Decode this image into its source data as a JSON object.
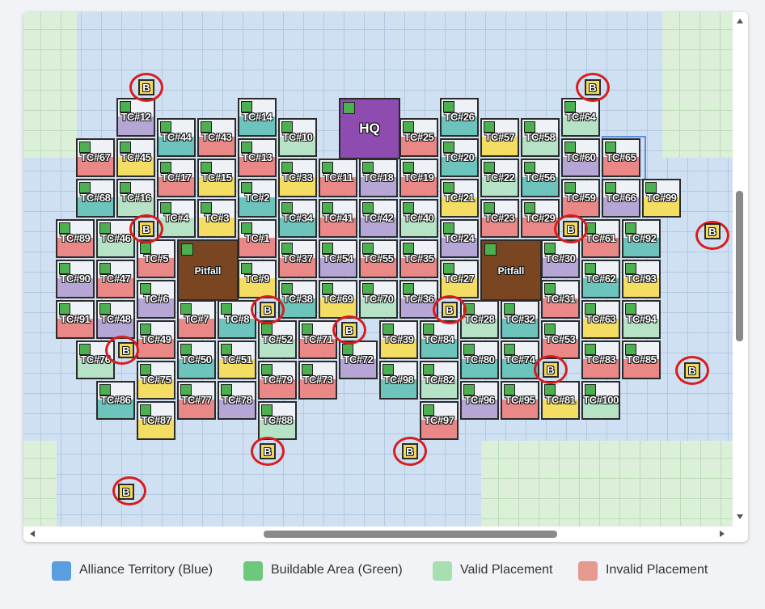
{
  "colors": {
    "teal": "#6cc4bd",
    "red": "#e98886",
    "lavender": "#b5a6d6",
    "mint": "#b6e3c6",
    "yellow": "#f4dd63",
    "hq": "#8e4bb0",
    "pitfall": "#7a4621",
    "ring": "#d91c1c",
    "legend_blue": "#5b9ee0",
    "legend_green": "#6cc97b",
    "legend_valid": "#a8dfb1",
    "legend_invalid": "#e5998f"
  },
  "hq": {
    "label": "HQ"
  },
  "pitfalls": [
    {
      "label": "Pitfall"
    },
    {
      "label": "Pitfall"
    }
  ],
  "tiles": [
    {
      "l": "TC#12",
      "c": "lavender"
    },
    {
      "l": "TC#14",
      "c": "teal"
    },
    {
      "l": "TC#26",
      "c": "teal"
    },
    {
      "l": "TC#64",
      "c": "mint"
    },
    {
      "l": "TC#44",
      "c": "teal"
    },
    {
      "l": "TC#43",
      "c": "red"
    },
    {
      "l": "TC#10",
      "c": "mint"
    },
    {
      "l": "TC#25",
      "c": "red"
    },
    {
      "l": "TC#57",
      "c": "yellow"
    },
    {
      "l": "TC#58",
      "c": "mint"
    },
    {
      "l": "TC#67",
      "c": "red"
    },
    {
      "l": "TC#45",
      "c": "yellow"
    },
    {
      "l": "TC#13",
      "c": "red"
    },
    {
      "l": "TC#20",
      "c": "teal"
    },
    {
      "l": "TC#60",
      "c": "lavender"
    },
    {
      "l": "TC#65",
      "c": "red"
    },
    {
      "l": "TC#17",
      "c": "red"
    },
    {
      "l": "TC#15",
      "c": "yellow"
    },
    {
      "l": "TC#33",
      "c": "yellow"
    },
    {
      "l": "TC#11",
      "c": "red"
    },
    {
      "l": "TC#18",
      "c": "lavender"
    },
    {
      "l": "TC#19",
      "c": "red"
    },
    {
      "l": "TC#22",
      "c": "mint"
    },
    {
      "l": "TC#56",
      "c": "teal"
    },
    {
      "l": "TC#68",
      "c": "teal"
    },
    {
      "l": "TC#16",
      "c": "mint"
    },
    {
      "l": "TC#2",
      "c": "teal"
    },
    {
      "l": "TC#21",
      "c": "yellow"
    },
    {
      "l": "TC#59",
      "c": "red"
    },
    {
      "l": "TC#66",
      "c": "lavender"
    },
    {
      "l": "TC#99",
      "c": "yellow"
    },
    {
      "l": "TC#4",
      "c": "mint"
    },
    {
      "l": "TC#3",
      "c": "yellow"
    },
    {
      "l": "TC#34",
      "c": "teal"
    },
    {
      "l": "TC#41",
      "c": "red"
    },
    {
      "l": "TC#42",
      "c": "lavender"
    },
    {
      "l": "TC#40",
      "c": "mint"
    },
    {
      "l": "TC#23",
      "c": "red"
    },
    {
      "l": "TC#29",
      "c": "red"
    },
    {
      "l": "TC#89",
      "c": "red"
    },
    {
      "l": "TC#46",
      "c": "mint"
    },
    {
      "l": "TC#1",
      "c": "red"
    },
    {
      "l": "TC#24",
      "c": "lavender"
    },
    {
      "l": "TC#61",
      "c": "red"
    },
    {
      "l": "TC#92",
      "c": "teal"
    },
    {
      "l": "TC#5",
      "c": "red"
    },
    {
      "l": "TC#37",
      "c": "red"
    },
    {
      "l": "TC#54",
      "c": "lavender"
    },
    {
      "l": "TC#55",
      "c": "red"
    },
    {
      "l": "TC#35",
      "c": "red"
    },
    {
      "l": "TC#30",
      "c": "lavender"
    },
    {
      "l": "TC#90",
      "c": "lavender"
    },
    {
      "l": "TC#47",
      "c": "red"
    },
    {
      "l": "TC#9",
      "c": "yellow"
    },
    {
      "l": "TC#27",
      "c": "yellow"
    },
    {
      "l": "TC#62",
      "c": "teal"
    },
    {
      "l": "TC#93",
      "c": "yellow"
    },
    {
      "l": "TC#6",
      "c": "lavender"
    },
    {
      "l": "TC#38",
      "c": "teal"
    },
    {
      "l": "TC#69",
      "c": "yellow"
    },
    {
      "l": "TC#70",
      "c": "mint"
    },
    {
      "l": "TC#36",
      "c": "lavender"
    },
    {
      "l": "TC#31",
      "c": "red"
    },
    {
      "l": "TC#91",
      "c": "red"
    },
    {
      "l": "TC#48",
      "c": "lavender"
    },
    {
      "l": "TC#7",
      "c": "red"
    },
    {
      "l": "TC#8",
      "c": "teal"
    },
    {
      "l": "TC#28",
      "c": "mint"
    },
    {
      "l": "TC#32",
      "c": "teal"
    },
    {
      "l": "TC#63",
      "c": "yellow"
    },
    {
      "l": "TC#94",
      "c": "mint"
    },
    {
      "l": "TC#49",
      "c": "red"
    },
    {
      "l": "TC#52",
      "c": "mint"
    },
    {
      "l": "TC#71",
      "c": "red"
    },
    {
      "l": "TC#39",
      "c": "yellow"
    },
    {
      "l": "TC#84",
      "c": "teal"
    },
    {
      "l": "TC#53",
      "c": "red"
    },
    {
      "l": "TC#76",
      "c": "mint"
    },
    {
      "l": "TC#50",
      "c": "teal"
    },
    {
      "l": "TC#51",
      "c": "yellow"
    },
    {
      "l": "TC#72",
      "c": "lavender"
    },
    {
      "l": "TC#80",
      "c": "teal"
    },
    {
      "l": "TC#74",
      "c": "teal"
    },
    {
      "l": "TC#83",
      "c": "red"
    },
    {
      "l": "TC#85",
      "c": "red"
    },
    {
      "l": "TC#75",
      "c": "yellow"
    },
    {
      "l": "TC#79",
      "c": "red"
    },
    {
      "l": "TC#73",
      "c": "red"
    },
    {
      "l": "TC#98",
      "c": "teal"
    },
    {
      "l": "TC#82",
      "c": "mint"
    },
    {
      "l": "TC#86",
      "c": "teal"
    },
    {
      "l": "TC#77",
      "c": "red"
    },
    {
      "l": "TC#78",
      "c": "lavender"
    },
    {
      "l": "TC#96",
      "c": "lavender"
    },
    {
      "l": "TC#95",
      "c": "red"
    },
    {
      "l": "TC#81",
      "c": "yellow"
    },
    {
      "l": "TC#100",
      "c": "mint"
    },
    {
      "l": "TC#87",
      "c": "yellow"
    },
    {
      "l": "TC#88",
      "c": "mint"
    },
    {
      "l": "TC#97",
      "c": "red"
    }
  ],
  "b_marker": {
    "label": "B",
    "count": 14
  },
  "legend": [
    {
      "label": "Alliance Territory (Blue)"
    },
    {
      "label": "Buildable Area (Green)"
    },
    {
      "label": "Valid Placement"
    },
    {
      "label": "Invalid Placement"
    }
  ]
}
